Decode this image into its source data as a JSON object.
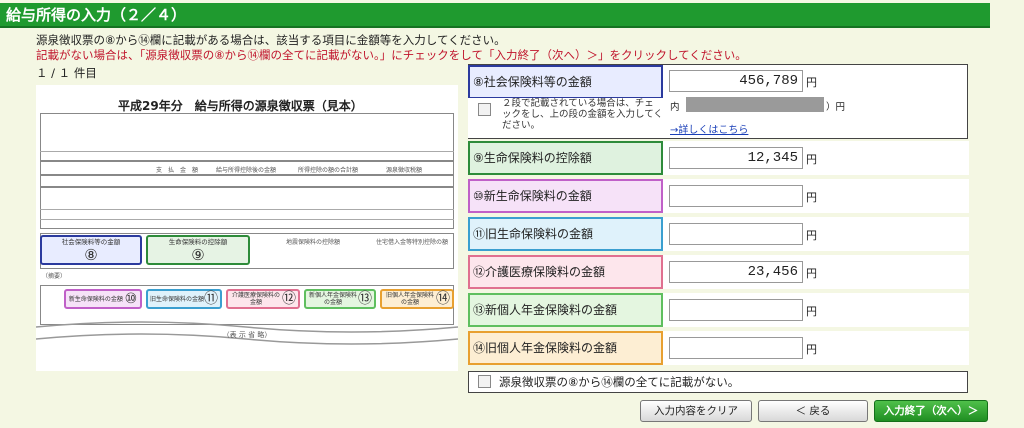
{
  "header": {
    "title": "給与所得の入力（２／４）"
  },
  "instructions": {
    "line1": "源泉徴収票の⑧から⑭欄に記載がある場合は、該当する項目に金額等を入力してください。",
    "line2": "記載がない場合は、「源泉徴収票の⑧から⑭欄の全てに記載がない。」にチェックをして「入力終了（次へ）＞」をクリックしてください。"
  },
  "sample": {
    "count": "１ / １ 件目",
    "title": "平成29年分　給与所得の源泉徴収票（見本）",
    "omitted": "（表 示 省 略）",
    "labels": {
      "shiharai": "支　払　金　額",
      "kyuyo": "給与所得控除後の金額",
      "shotoku": "所得控除の額の合計額",
      "gensen": "源泉徴収税額",
      "shakai": "社会保険料等の金額",
      "seimei": "生命保険料の控除額",
      "jishin": "地震保険料の控除額",
      "jutaku": "住宅借入金等特別控除の額",
      "tekiyo": "（摘要）"
    },
    "boxes": [
      {
        "num": "⑧",
        "label": "社会保険料等の金額"
      },
      {
        "num": "⑨",
        "label": "生命保険料の控除額"
      },
      {
        "num": "⑩",
        "label": "新生命保険料の金額"
      },
      {
        "num": "⑪",
        "label": "旧生命保険料の金額"
      },
      {
        "num": "⑫",
        "label": "介護医療保険料の金額"
      },
      {
        "num": "⑬",
        "label": "新個人年金保険料の金額"
      },
      {
        "num": "⑭",
        "label": "旧個人年金保険料の金額"
      }
    ]
  },
  "rows": [
    {
      "label": "⑧社会保険料等の金額",
      "value": "456,789",
      "unit": "円"
    },
    {
      "label": "⑨生命保険料の控除額",
      "value": "12,345",
      "unit": "円"
    },
    {
      "label": "⑩新生命保険料の金額",
      "value": "",
      "unit": "円"
    },
    {
      "label": "⑪旧生命保険料の金額",
      "value": "",
      "unit": "円"
    },
    {
      "label": "⑫介護医療保険料の金額",
      "value": "23,456",
      "unit": "円"
    },
    {
      "label": "⑬新個人年金保険料の金額",
      "value": "",
      "unit": "円"
    },
    {
      "label": "⑭旧個人年金保険料の金額",
      "value": "",
      "unit": "円"
    }
  ],
  "two_tier": {
    "checkbox_label": "２段で記載されている場合は、チェックをし、上の段の金額を入力してください。",
    "inner_prefix": "内（",
    "inner_suffix": "）円",
    "detail_link": "→詳しくはこちら"
  },
  "none_checkbox": {
    "label": "源泉徴収票の⑧から⑭欄の全てに記載がない。"
  },
  "buttons": {
    "clear": "入力内容をクリア",
    "back": "＜ 戻る",
    "next": "入力終了（次へ）＞"
  },
  "colors": {
    "header_green": "#1f9a2f",
    "row8_border": "#2b3a9e",
    "row8_bg": "#e8ecff",
    "row9_border": "#2e8b3a",
    "row9_bg": "#dff2df",
    "row10_border": "#c060c8",
    "row10_bg": "#f6e2f8",
    "row11_border": "#3a9fd0",
    "row11_bg": "#dff2fb",
    "row12_border": "#e07090",
    "row12_bg": "#fde6ec",
    "row13_border": "#5fbf5f",
    "row13_bg": "#e4f6e0",
    "row14_border": "#e8a030",
    "row14_bg": "#fdeed3"
  }
}
